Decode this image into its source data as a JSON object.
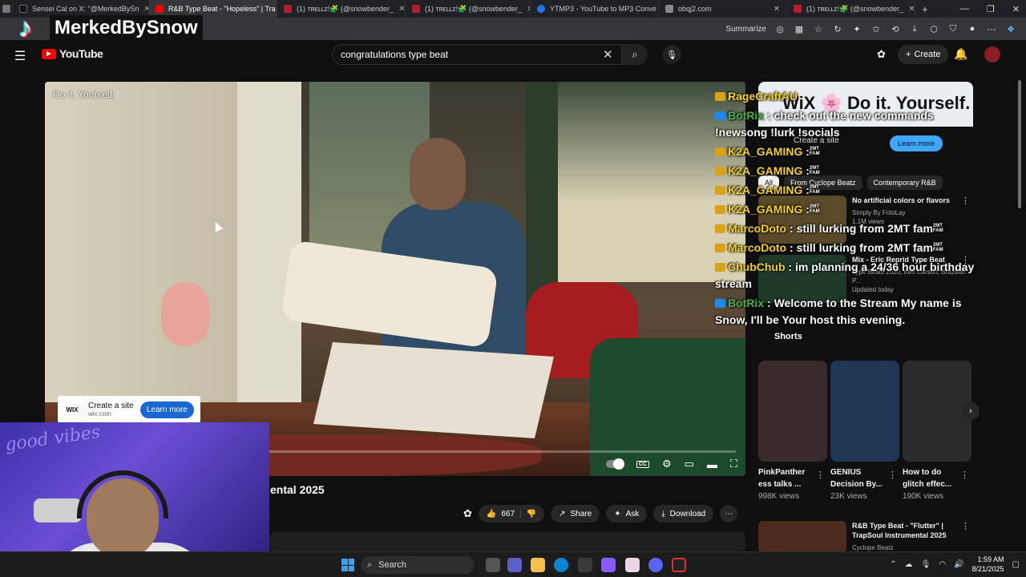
{
  "browser": {
    "tabs": [
      {
        "title": "Sensei Cal on X: \"@MerkedBySn",
        "color": "#111111"
      },
      {
        "title": "R&B Type Beat - \"Hopeless\" | Tra",
        "color": "#ff0000",
        "active": true
      },
      {
        "title": "(1) ᴛʀᴇʟʟᴢ!🧩 (@snowbender_",
        "color": "#b3202a"
      },
      {
        "title": "(1) ᴛʀᴇʟʟᴢ!🧩 (@snowbender_",
        "color": "#b3202a"
      },
      {
        "title": "YTMP3 - YouTube to MP3 Conve",
        "color": "#1a73e8"
      },
      {
        "title": "obqj2.com",
        "color": "#888888"
      },
      {
        "title": "(1) ᴛʀᴇʟʟᴢ!🧩 (@snowbender_",
        "color": "#b3202a"
      }
    ],
    "new_tab": "+",
    "window_controls": [
      "—",
      "❐",
      "✕"
    ],
    "summarize_label": "Summarize"
  },
  "overlay": {
    "tiktok_logo": "♪",
    "tiktok_name": "MerkedBySnow"
  },
  "youtube": {
    "logo_text": "YouTube",
    "search_value": "congratulations type beat",
    "create_label": "Create",
    "hamburger": "☰",
    "clear": "✕",
    "search_icon": "⌕",
    "mic_icon": "🎙",
    "bell_icon": "🔔"
  },
  "video": {
    "caption": "Do it. Yourself.",
    "title": "ental 2025",
    "progress": 0.16,
    "controls": [
      "⚙",
      "▭",
      "▬",
      "⛶"
    ],
    "cc": "CC"
  },
  "wix_ad": {
    "logo": "WIX",
    "title": "Create a site",
    "domain": "wix.com",
    "button": "Learn more"
  },
  "actions": {
    "likes": "667",
    "share": "Share",
    "ask": "Ask",
    "download": "Download",
    "more": "⋯"
  },
  "webcam": {
    "neon_text": "good vibes"
  },
  "chat": [
    {
      "user": "RageCraftAU",
      "color": "yellow",
      "message": "",
      "fam": false
    },
    {
      "user": "BotRix",
      "color": "green",
      "message": " : check out the new commands !newsong !lurk !socials",
      "fam": false
    },
    {
      "user": "K2A_GAMING",
      "color": "yellow",
      "message": " :",
      "fam": true
    },
    {
      "user": "K2A_GAMING",
      "color": "yellow",
      "message": " :",
      "fam": true
    },
    {
      "user": "K2A_GAMING",
      "color": "yellow",
      "message": " :",
      "fam": true
    },
    {
      "user": "K2A_GAMING",
      "color": "yellow",
      "message": " :",
      "fam": true
    },
    {
      "user": "MarcoDoto",
      "color": "yellow",
      "message": " : still lurking from 2MT fam",
      "fam": true
    },
    {
      "user": "MarcoDoto",
      "color": "yellow",
      "message": " : still lurking from 2MT fam",
      "fam": true
    },
    {
      "user": "ChubChub",
      "color": "yellow",
      "message": " : im planning a 24/36 hour birthday stream",
      "fam": false
    },
    {
      "user": "BotRix",
      "color": "green",
      "message": " : Welcome to the Stream My name is Snow, I'll be Your host this evening.",
      "fam": false
    }
  ],
  "fam_label": "2MT FAM",
  "sidebar": {
    "ad_banner": "WiX 🌸 Do it. Yourself.",
    "ad_title": "Create a site",
    "ad_learn": "Learn more",
    "chips": [
      "All",
      "From Cyclope Beatz",
      "Contemporary R&B"
    ],
    "recs": [
      {
        "title": "No artificial colors or flavors",
        "meta": "Simply By FritoLay",
        "meta2": "1.1M views"
      },
      {
        "title": "Mix - Eric Reprid Type Beat",
        "meta": "Type Beats 2020, Ken Carson, Brazilian P...",
        "meta2": "Updated today"
      }
    ],
    "shorts_label": "Shorts",
    "shorts": [
      {
        "title": "PinkPanther ess talks ...",
        "views": "998K views",
        "color": "#3a2a2a"
      },
      {
        "title": "GENIUS Decision By...",
        "views": "23K views",
        "color": "#1e3553"
      },
      {
        "title": "How to do glitch effec...",
        "views": "190K views",
        "color": "#2b2b2b"
      }
    ],
    "bottom_rec": {
      "title": "R&B Type Beat - \"Flutter\" | TrapSoul Instrumental 2025",
      "meta": "Cyclope Beatz"
    }
  },
  "taskbar": {
    "search_label": "Search",
    "time": "1:59 AM",
    "date": "8/21/2025"
  }
}
